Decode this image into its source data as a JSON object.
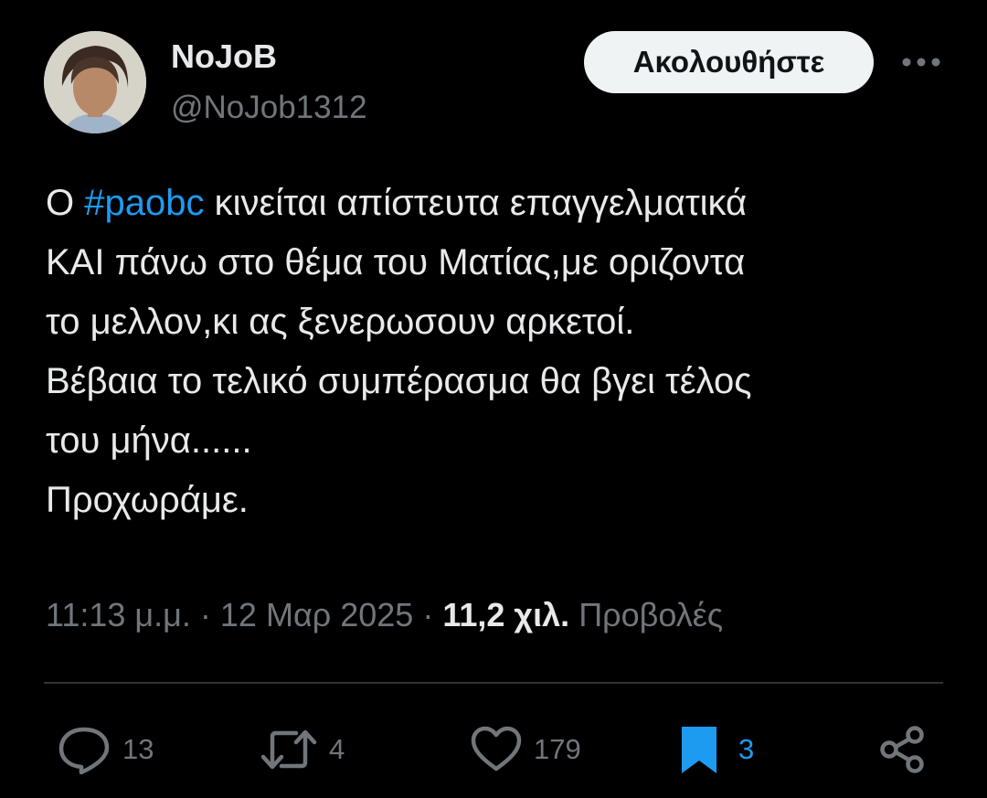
{
  "author": {
    "display_name": "NoJoB",
    "handle": "@NoJob1312"
  },
  "follow_label": "Ακολουθήστε",
  "tweet": {
    "lines": [
      [
        "Ο ",
        "#paobc",
        " κινείται απίστευτα επαγγελματικά"
      ],
      "ΚΑΙ πάνω στο θέμα του Ματίας,με οριζοντα",
      "το μελλον,κι ας ξενερωσουν αρκετοί.",
      "Βέβαια το τελικό συμπέρασμα θα βγει τέλος",
      "του μήνα......",
      "Προχωράμε."
    ],
    "prefix": "Ο ",
    "hashtag": "#paobc",
    "rest_line1": " κινείται απίστευτα επαγγελματικά",
    "line2": "ΚΑΙ πάνω στο θέμα του Ματίας,με οριζοντα",
    "line3": "το μελλον,κι ας ξενερωσουν αρκετοί.",
    "line4": "Βέβαια το τελικό συμπέρασμα θα βγει τέλος",
    "line5": "του μήνα......",
    "line6": "Προχωράμε."
  },
  "meta": {
    "time": "11:13 μ.μ.",
    "separator": " · ",
    "date": "12 Μαρ 2025",
    "views_count": "11,2 χιλ.",
    "views_label": "Προβολές"
  },
  "actions": {
    "replies": "13",
    "reposts": "4",
    "likes": "179",
    "bookmarks": "3"
  },
  "colors": {
    "background": "#000000",
    "text": "#e7e9ea",
    "secondary": "#71767b",
    "accent": "#1d9bf0",
    "divider": "#2f3336"
  },
  "icons": {
    "more": "more-horizontal-icon",
    "reply": "reply-icon",
    "repost": "repost-icon",
    "like": "heart-icon",
    "bookmark": "bookmark-icon",
    "share": "share-icon"
  }
}
